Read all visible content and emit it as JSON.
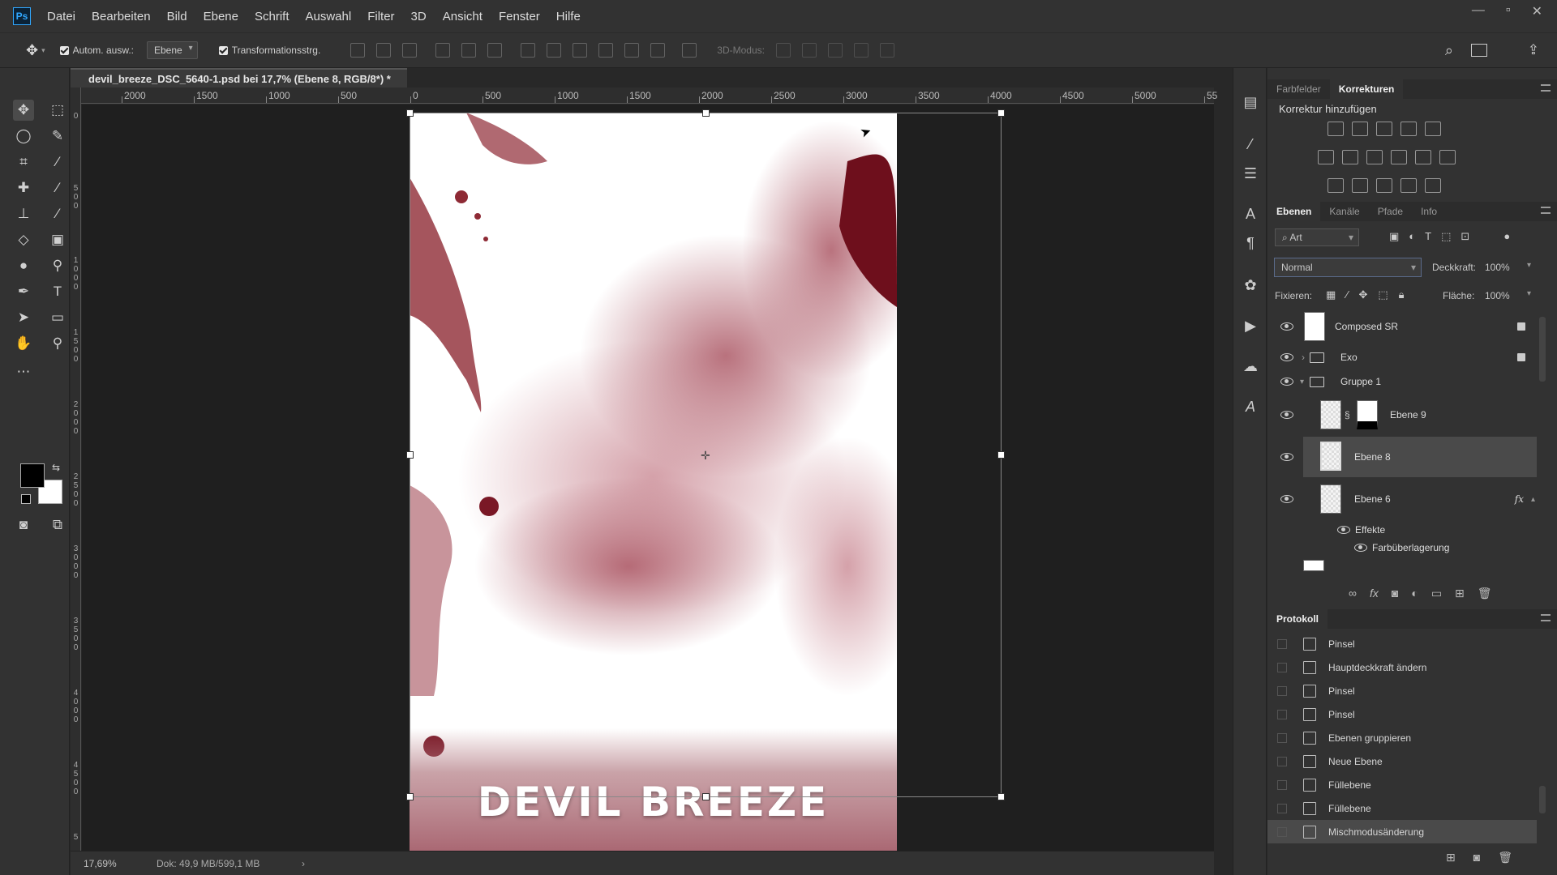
{
  "menubar": {
    "logo": "Ps",
    "items": [
      "Datei",
      "Bearbeiten",
      "Bild",
      "Ebene",
      "Schrift",
      "Auswahl",
      "Filter",
      "3D",
      "Ansicht",
      "Fenster",
      "Hilfe"
    ]
  },
  "options": {
    "auto_select_label": "Autom. ausw.:",
    "auto_select_value": "Ebene",
    "transform_label": "Transformationsstrg.",
    "mode_3d": "3D-Modus:"
  },
  "document": {
    "tab_title": "devil_breeze_DSC_5640-1.psd bei 17,7% (Ebene 8, RGB/8*) *",
    "art_title": "DEVIL BREEZE"
  },
  "ruler_h": [
    "2000",
    "1500",
    "1000",
    "500",
    "0",
    "500",
    "1000",
    "1500",
    "2000",
    "2500",
    "3000",
    "3500",
    "4000",
    "4500",
    "5000",
    "55"
  ],
  "ruler_v": [
    "0",
    "500",
    "1000",
    "1500",
    "2000",
    "2500",
    "3000",
    "3500",
    "4000",
    "4500",
    "5"
  ],
  "status": {
    "zoom": "17,69%",
    "doc": "Dok: 49,9 MB/599,1 MB"
  },
  "panels": {
    "top_tabs": [
      "Farbfelder",
      "Korrekturen"
    ],
    "korr_title": "Korrektur hinzufügen",
    "layer_tabs": [
      "Ebenen",
      "Kanäle",
      "Pfade",
      "Info"
    ],
    "filter_kind": "Art",
    "blend_mode": "Normal",
    "opacity_label": "Deckkraft:",
    "opacity_value": "100%",
    "lock_label": "Fixieren:",
    "fill_label": "Fläche:",
    "fill_value": "100%",
    "layers": [
      {
        "name": "Composed SR"
      },
      {
        "name": "Exo"
      },
      {
        "name": "Gruppe 1"
      },
      {
        "name": "Ebene 9"
      },
      {
        "name": "Ebene 8"
      },
      {
        "name": "Ebene 6"
      },
      {
        "name": "Effekte"
      },
      {
        "name": "Farbüberlagerung"
      }
    ],
    "fx_label": "fx",
    "history_title": "Protokoll",
    "history": [
      "Pinsel",
      "Hauptdeckkraft ändern",
      "Pinsel",
      "Pinsel",
      "Ebenen gruppieren",
      "Neue Ebene",
      "Füllebene",
      "Füllebene",
      "Mischmodusänderung"
    ]
  },
  "colors": {
    "accent": "#31a8ff",
    "art_red": "#8e2a35",
    "bg": "#1f1f1f"
  }
}
